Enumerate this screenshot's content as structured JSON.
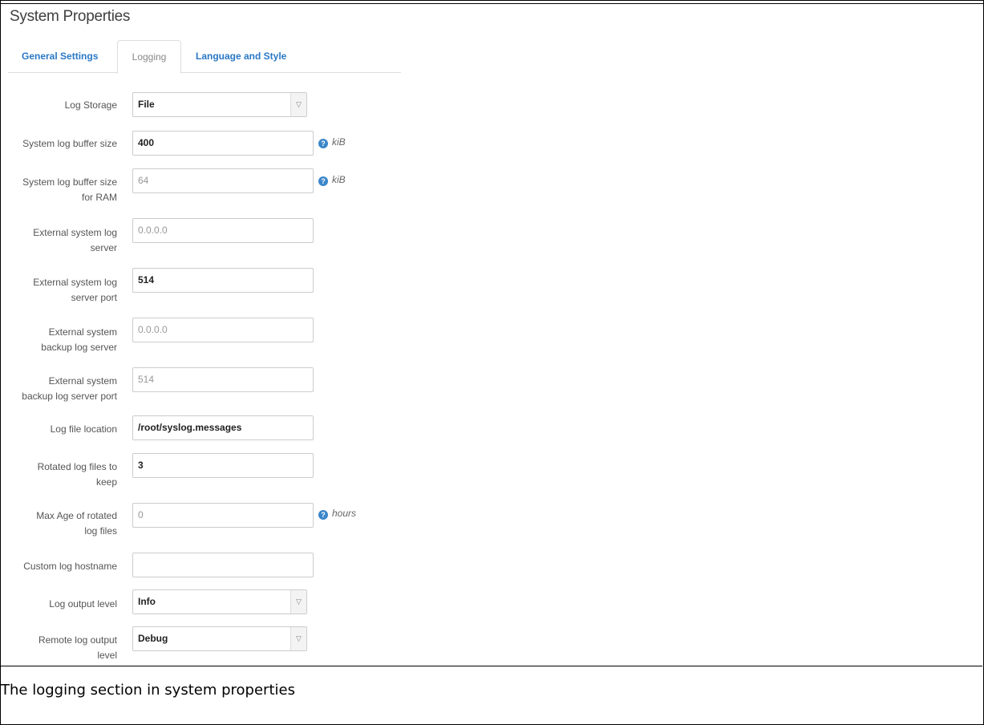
{
  "header": {
    "title": "System Properties"
  },
  "tabs": [
    {
      "label": "General Settings",
      "active": false
    },
    {
      "label": "Logging",
      "active": true
    },
    {
      "label": "Language and Style",
      "active": false
    }
  ],
  "fields": {
    "log_storage": {
      "label": "Log Storage",
      "value": "File"
    },
    "buffer_size": {
      "label": "System log buffer size",
      "value": "400",
      "unit": "kiB"
    },
    "buffer_ram": {
      "label_line1": "System log buffer size",
      "label_line2": "for RAM",
      "placeholder": "64",
      "unit": "kiB"
    },
    "ext_server": {
      "label_line1": "External system log",
      "label_line2": "server",
      "placeholder": "0.0.0.0"
    },
    "ext_server_port": {
      "label_line1": "External system log",
      "label_line2": "server port",
      "value": "514"
    },
    "ext_backup": {
      "label_line1": "External system",
      "label_line2": "backup log server",
      "placeholder": "0.0.0.0"
    },
    "ext_backup_port": {
      "label_line1": "External system",
      "label_line2": "backup log server port",
      "placeholder": "514"
    },
    "log_file": {
      "label": "Log file location",
      "value": "/root/syslog.messages"
    },
    "rotated": {
      "label_line1": "Rotated log files to",
      "label_line2": "keep",
      "value": "3"
    },
    "max_age": {
      "label_line1": "Max Age of rotated",
      "label_line2": "log files",
      "placeholder": "0",
      "unit": "hours"
    },
    "hostname": {
      "label": "Custom log hostname",
      "value": ""
    },
    "output_level": {
      "label": "Log output level",
      "value": "Info"
    },
    "remote_level": {
      "label_line1": "Remote log output",
      "label_line2": "level",
      "value": "Debug"
    }
  },
  "help_icon_glyph": "?",
  "caption": "The logging section in system properties",
  "colors": {
    "link": "#2a78c6",
    "help_icon": "#3b86c9"
  }
}
